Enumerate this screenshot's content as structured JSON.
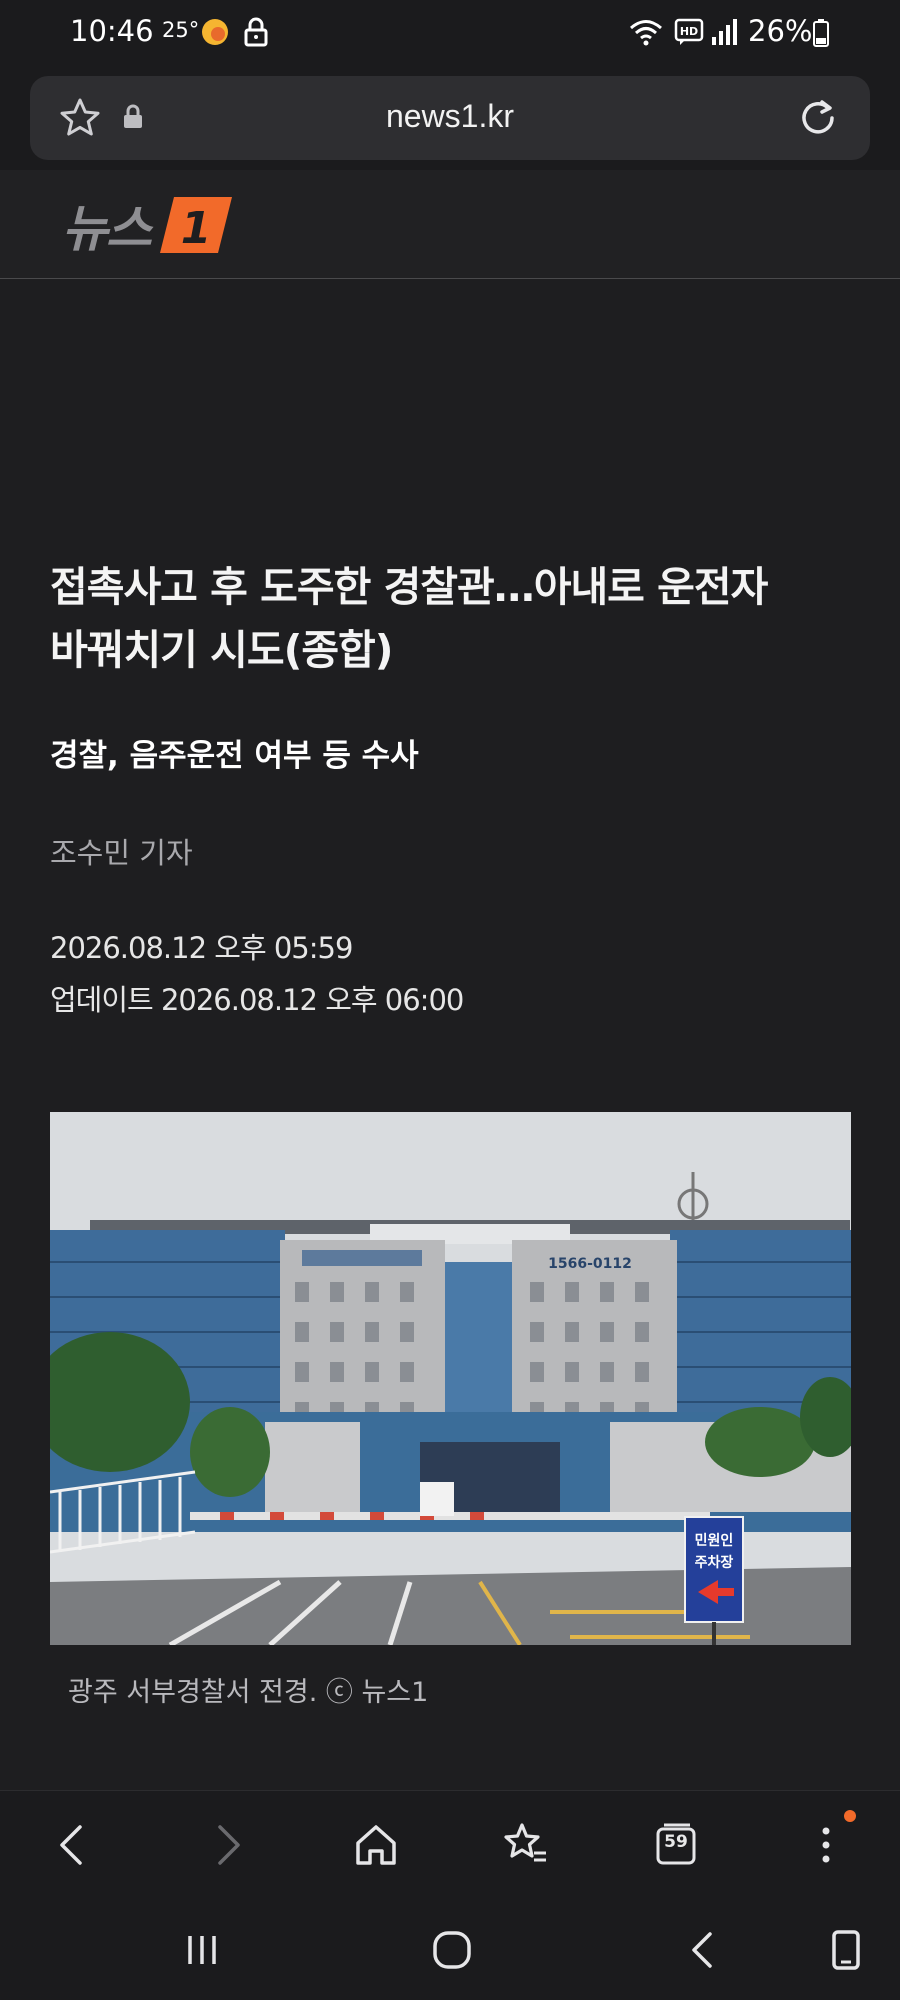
{
  "status_bar": {
    "time": "10:46",
    "temperature": "25°",
    "battery": "26%",
    "icons": [
      "weather-icon",
      "lock-icon",
      "wifi-icon",
      "hd-voice-icon",
      "signal-icon",
      "battery-icon"
    ]
  },
  "browser": {
    "url": "news1.kr",
    "icons": [
      "bookmark-star-icon",
      "padlock-icon",
      "reload-icon"
    ]
  },
  "site": {
    "logo_text": "뉴스",
    "logo_mark": "1",
    "brand_color": "#f26a2a"
  },
  "article": {
    "headline_line1": "접촉사고 후 도주한 경찰관…아내로 운전자",
    "headline_line2": "바꿔치기 시도(종합)",
    "subheadline": "경찰, 음주운전 여부 등 수사",
    "byline": "조수민 기자",
    "published": "2026.08.12 오후 05:59",
    "updated": "업데이트 2026.08.12 오후 06:00",
    "photo": {
      "building_sign_phone": "1566-0112",
      "parking_sign_line1": "민원인",
      "parking_sign_line2": "주차장"
    },
    "caption": "광주 서부경찰서 전경. ⓒ 뉴스1"
  },
  "toolbar": {
    "tabs_count": "59",
    "icons": [
      "back-icon",
      "forward-icon",
      "home-icon",
      "bookmarks-icon",
      "tabs-icon",
      "menu-icon"
    ]
  },
  "nav_bar": {
    "icons": [
      "recent-apps-icon",
      "home-circle-icon",
      "nav-back-icon",
      "keyboard-icon"
    ]
  }
}
